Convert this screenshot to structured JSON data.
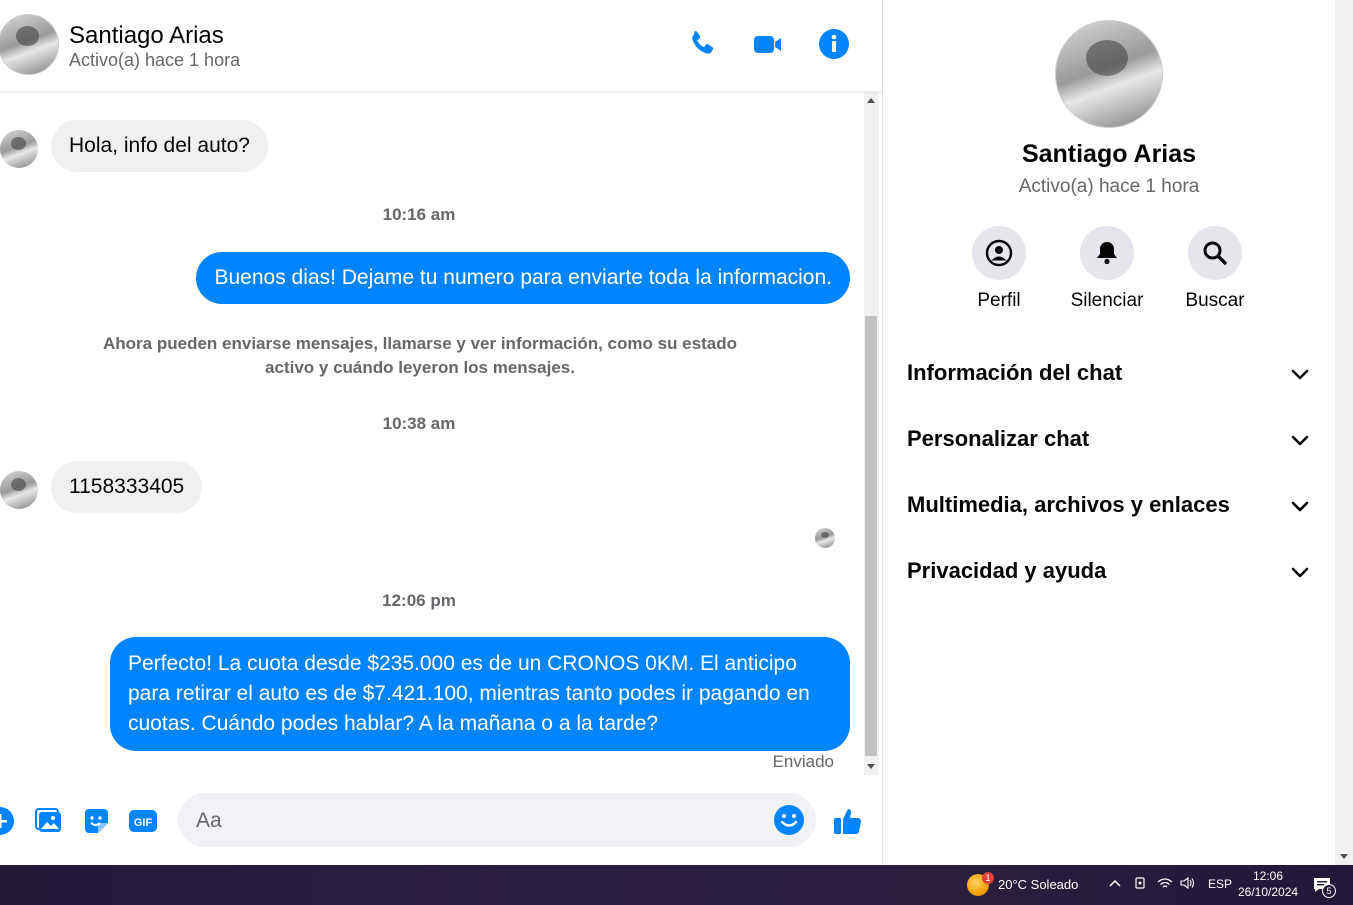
{
  "contact": {
    "name": "Santiago Arias",
    "status": "Activo(a) hace 1 hora"
  },
  "header": {
    "icons": [
      "phone-icon",
      "video-icon",
      "info-icon"
    ]
  },
  "messages": [
    {
      "type": "incoming",
      "text": "Hola, info del auto?"
    },
    {
      "type": "timestamp",
      "text": "10:16 am"
    },
    {
      "type": "outgoing",
      "text": "Buenos dias! Dejame tu numero para enviarte toda la informacion."
    },
    {
      "type": "system",
      "text": "Ahora pueden enviarse mensajes, llamarse y ver información, como su estado activo y cuándo leyeron los mensajes."
    },
    {
      "type": "timestamp",
      "text": "10:38 am"
    },
    {
      "type": "incoming",
      "text": "1158333405"
    },
    {
      "type": "timestamp",
      "text": "12:06 pm"
    },
    {
      "type": "outgoing",
      "text": "Perfecto! La cuota desde $235.000 es de un CRONOS 0KM. El anticipo para retirar el auto es de $7.421.100, mientras tanto podes ir pagando en cuotas. Cuándo podes hablar? A la mañana o a la tarde?"
    }
  ],
  "sent_label": "Enviado",
  "composer": {
    "placeholder": "Aa",
    "icons": [
      "plus-icon",
      "photo-icon",
      "sticker-icon",
      "gif-icon",
      "emoji-icon",
      "like-icon"
    ]
  },
  "panel": {
    "actions": [
      {
        "label": "Perfil",
        "icon": "profile-icon"
      },
      {
        "label": "Silenciar",
        "icon": "bell-icon"
      },
      {
        "label": "Buscar",
        "icon": "search-icon"
      }
    ],
    "sections": [
      "Información del chat",
      "Personalizar chat",
      "Multimedia, archivos y enlaces",
      "Privacidad y ayuda"
    ]
  },
  "taskbar": {
    "weather_badge": "1",
    "weather": "20°C  Soleado",
    "lang": "ESP",
    "time": "12:06",
    "date": "26/10/2024",
    "notif_count": "5"
  },
  "colors": {
    "accent": "#0084ff",
    "bubble_in": "#f0f0f0",
    "muted_text": "#65676b"
  }
}
